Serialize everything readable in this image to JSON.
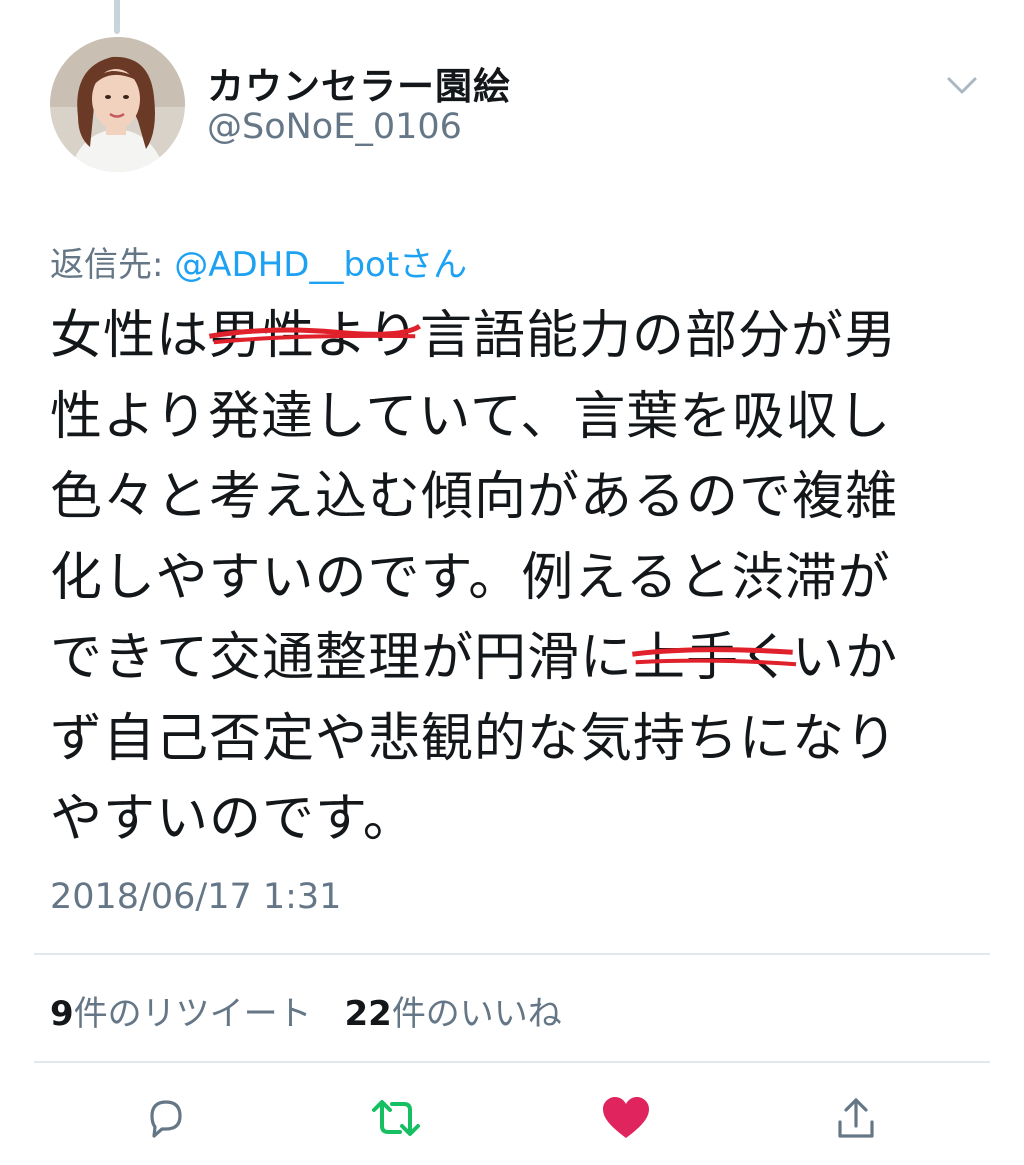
{
  "user": {
    "display_name": "カウンセラー園絵",
    "handle": "@SoNoE_0106"
  },
  "reply": {
    "prefix": "返信先: ",
    "mention": "@ADHD__botさん"
  },
  "tweet": {
    "line1_pre": "女性は",
    "line1_strike": "男性より",
    "line1_post": "言語能力の部分が男",
    "line2": "性より発達していて、言葉を吸収し",
    "line3": "色々と考え込む傾向があるので複雑",
    "line4": "化しやすいのです。例えると渋滞が",
    "line5_pre": "できて交通整理が円滑に",
    "line5_strike": "上手く",
    "line5_post": "いか",
    "line6": "ず自己否定や悲観的な気持ちになり",
    "line7": "やすいのです。"
  },
  "timestamp": "2018/06/17 1:31",
  "stats": {
    "retweet_count": "9",
    "retweet_label": "件のリツイート",
    "like_count": "22",
    "like_label": "件のいいね"
  },
  "colors": {
    "retweet_active": "#17bf63",
    "like_active": "#e0245e",
    "strike_red": "#e0202a",
    "mention_blue": "#1da1f2",
    "muted": "#657786"
  },
  "icons": [
    "chevron-down-icon",
    "reply-icon",
    "retweet-icon",
    "heart-icon",
    "share-icon"
  ]
}
